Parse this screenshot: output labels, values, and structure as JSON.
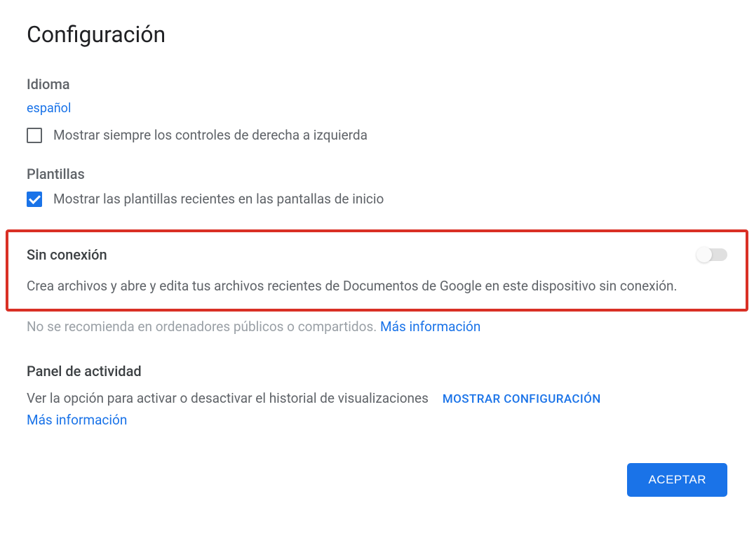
{
  "title": "Configuración",
  "language": {
    "heading": "Idioma",
    "value": "español",
    "rtl_label": "Mostrar siempre los controles de derecha a izquierda",
    "rtl_checked": false
  },
  "templates": {
    "heading": "Plantillas",
    "recent_label": "Mostrar las plantillas recientes en las pantallas de inicio",
    "recent_checked": true
  },
  "offline": {
    "heading": "Sin conexión",
    "description": "Crea archivos y abre y edita tus archivos recientes de Documentos de Google en este dispositivo sin conexión.",
    "warning_prefix": "No se recomienda en ordenadores públicos o compartidos. ",
    "more_info": "Más información",
    "toggle_on": false
  },
  "activity": {
    "heading": "Panel de actividad",
    "description": "Ver la opción para activar o desactivar el historial de visualizaciones",
    "show_config": "MOSTRAR CONFIGURACIÓN",
    "more_info": "Más información"
  },
  "buttons": {
    "accept": "ACEPTAR"
  }
}
